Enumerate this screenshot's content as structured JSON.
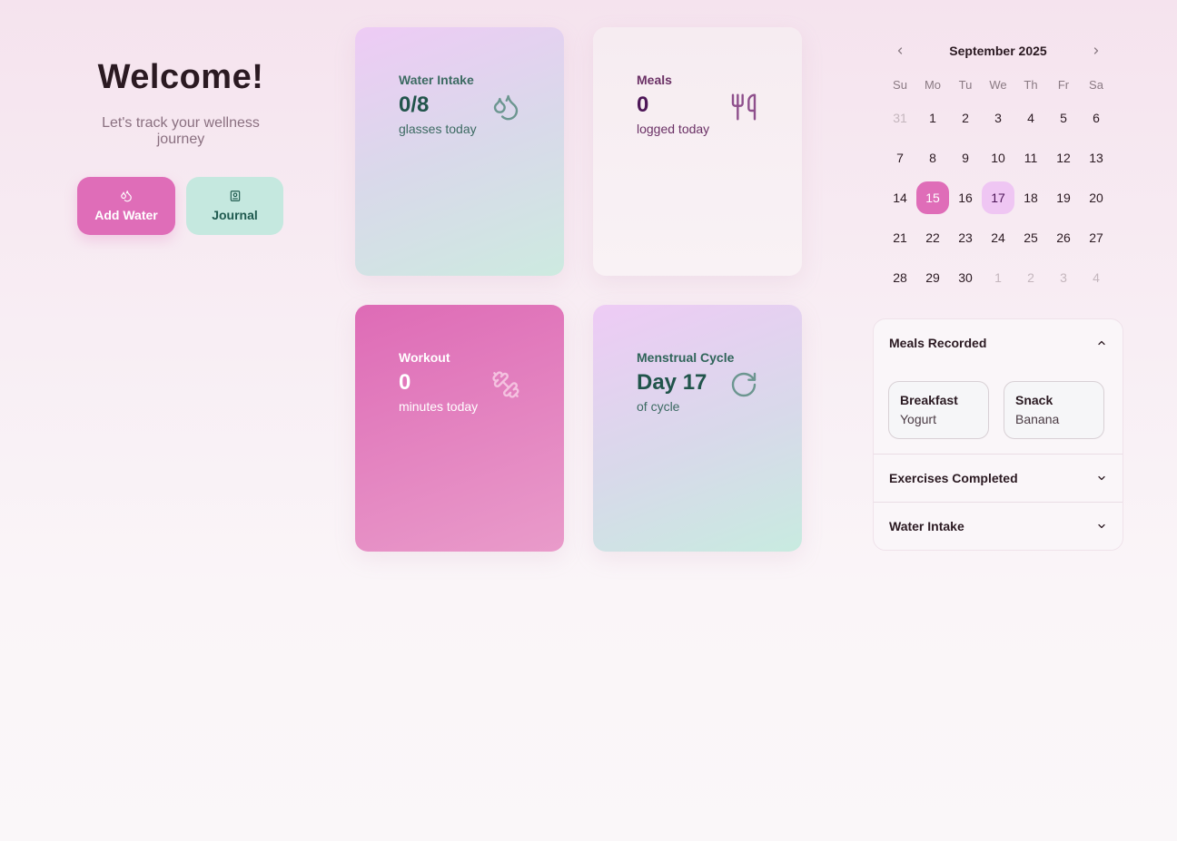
{
  "hero": {
    "title": "Welcome!",
    "subtitle": "Let's track your wellness journey",
    "add_water_label": "Add Water",
    "journal_label": "Journal"
  },
  "cards": {
    "water": {
      "label": "Water Intake",
      "value": "0/8",
      "sub": "glasses today",
      "icon": "water-drops-icon"
    },
    "meals": {
      "label": "Meals",
      "value": "0",
      "sub": "logged today",
      "icon": "utensils-icon"
    },
    "workout": {
      "label": "Workout",
      "value": "0",
      "sub": "minutes today",
      "icon": "dumbbell-icon"
    },
    "cycle": {
      "label": "Menstrual Cycle",
      "value": "Day 17",
      "sub": "of cycle",
      "icon": "refresh-icon"
    }
  },
  "calendar": {
    "month_label": "September 2025",
    "weekdays": [
      "Su",
      "Mo",
      "Tu",
      "We",
      "Th",
      "Fr",
      "Sa"
    ],
    "selected_day": 15,
    "today_day": 17,
    "weeks": [
      [
        {
          "d": "31",
          "muted": true
        },
        {
          "d": "1"
        },
        {
          "d": "2"
        },
        {
          "d": "3"
        },
        {
          "d": "4"
        },
        {
          "d": "5"
        },
        {
          "d": "6"
        }
      ],
      [
        {
          "d": "7"
        },
        {
          "d": "8"
        },
        {
          "d": "9"
        },
        {
          "d": "10"
        },
        {
          "d": "11"
        },
        {
          "d": "12"
        },
        {
          "d": "13"
        }
      ],
      [
        {
          "d": "14"
        },
        {
          "d": "15"
        },
        {
          "d": "16"
        },
        {
          "d": "17"
        },
        {
          "d": "18"
        },
        {
          "d": "19"
        },
        {
          "d": "20"
        }
      ],
      [
        {
          "d": "21"
        },
        {
          "d": "22"
        },
        {
          "d": "23"
        },
        {
          "d": "24"
        },
        {
          "d": "25"
        },
        {
          "d": "26"
        },
        {
          "d": "27"
        }
      ],
      [
        {
          "d": "28"
        },
        {
          "d": "29"
        },
        {
          "d": "30"
        },
        {
          "d": "1",
          "muted": true
        },
        {
          "d": "2",
          "muted": true
        },
        {
          "d": "3",
          "muted": true
        },
        {
          "d": "4",
          "muted": true
        }
      ]
    ]
  },
  "panels": {
    "meals_recorded": {
      "title": "Meals Recorded",
      "expanded": true,
      "items": [
        {
          "type": "Breakfast",
          "food": "Yogurt"
        },
        {
          "type": "Snack",
          "food": "Banana"
        }
      ]
    },
    "exercises": {
      "title": "Exercises Completed",
      "expanded": false
    },
    "water": {
      "title": "Water Intake",
      "expanded": false
    }
  },
  "colors": {
    "accent_pink": "#df6db8",
    "mint": "#c5e8df",
    "today_lilac": "#efc6f3"
  }
}
